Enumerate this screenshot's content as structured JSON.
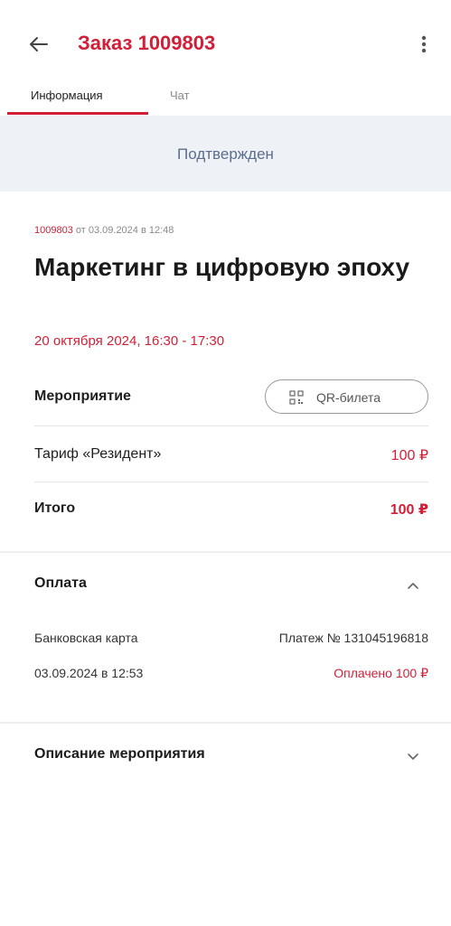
{
  "header": {
    "title": "Заказ 1009803",
    "back_icon": "arrow-left-icon",
    "menu_icon": "more-vertical-icon"
  },
  "tabs": [
    {
      "label": "Информация",
      "active": true
    },
    {
      "label": "Чат",
      "active": false
    }
  ],
  "status": {
    "label": "Подтвержден"
  },
  "order": {
    "number": "1009803",
    "date_text": "от 03.09.2024 в 12:48",
    "event_title": "Маркетинг в цифровую эпоху",
    "event_date": "20 октября 2024, 16:30 - 17:30"
  },
  "event_section": {
    "label": "Мероприятие",
    "qr_button": "QR-билета",
    "tariff_label": "Тариф «Резидент»",
    "tariff_price": "100 ₽",
    "total_label": "Итого",
    "total_price": "100 ₽"
  },
  "payment": {
    "title": "Оплата",
    "method": "Банковская карта",
    "payment_number": "Платеж № 131045196818",
    "datetime": "03.09.2024 в 12:53",
    "status": "Оплачено 100 ₽",
    "expanded": true
  },
  "description": {
    "title": "Описание мероприятия",
    "expanded": false
  },
  "colors": {
    "accent": "#d21f37",
    "status_bg": "#eef1f5",
    "status_text": "#5b6f8c"
  }
}
